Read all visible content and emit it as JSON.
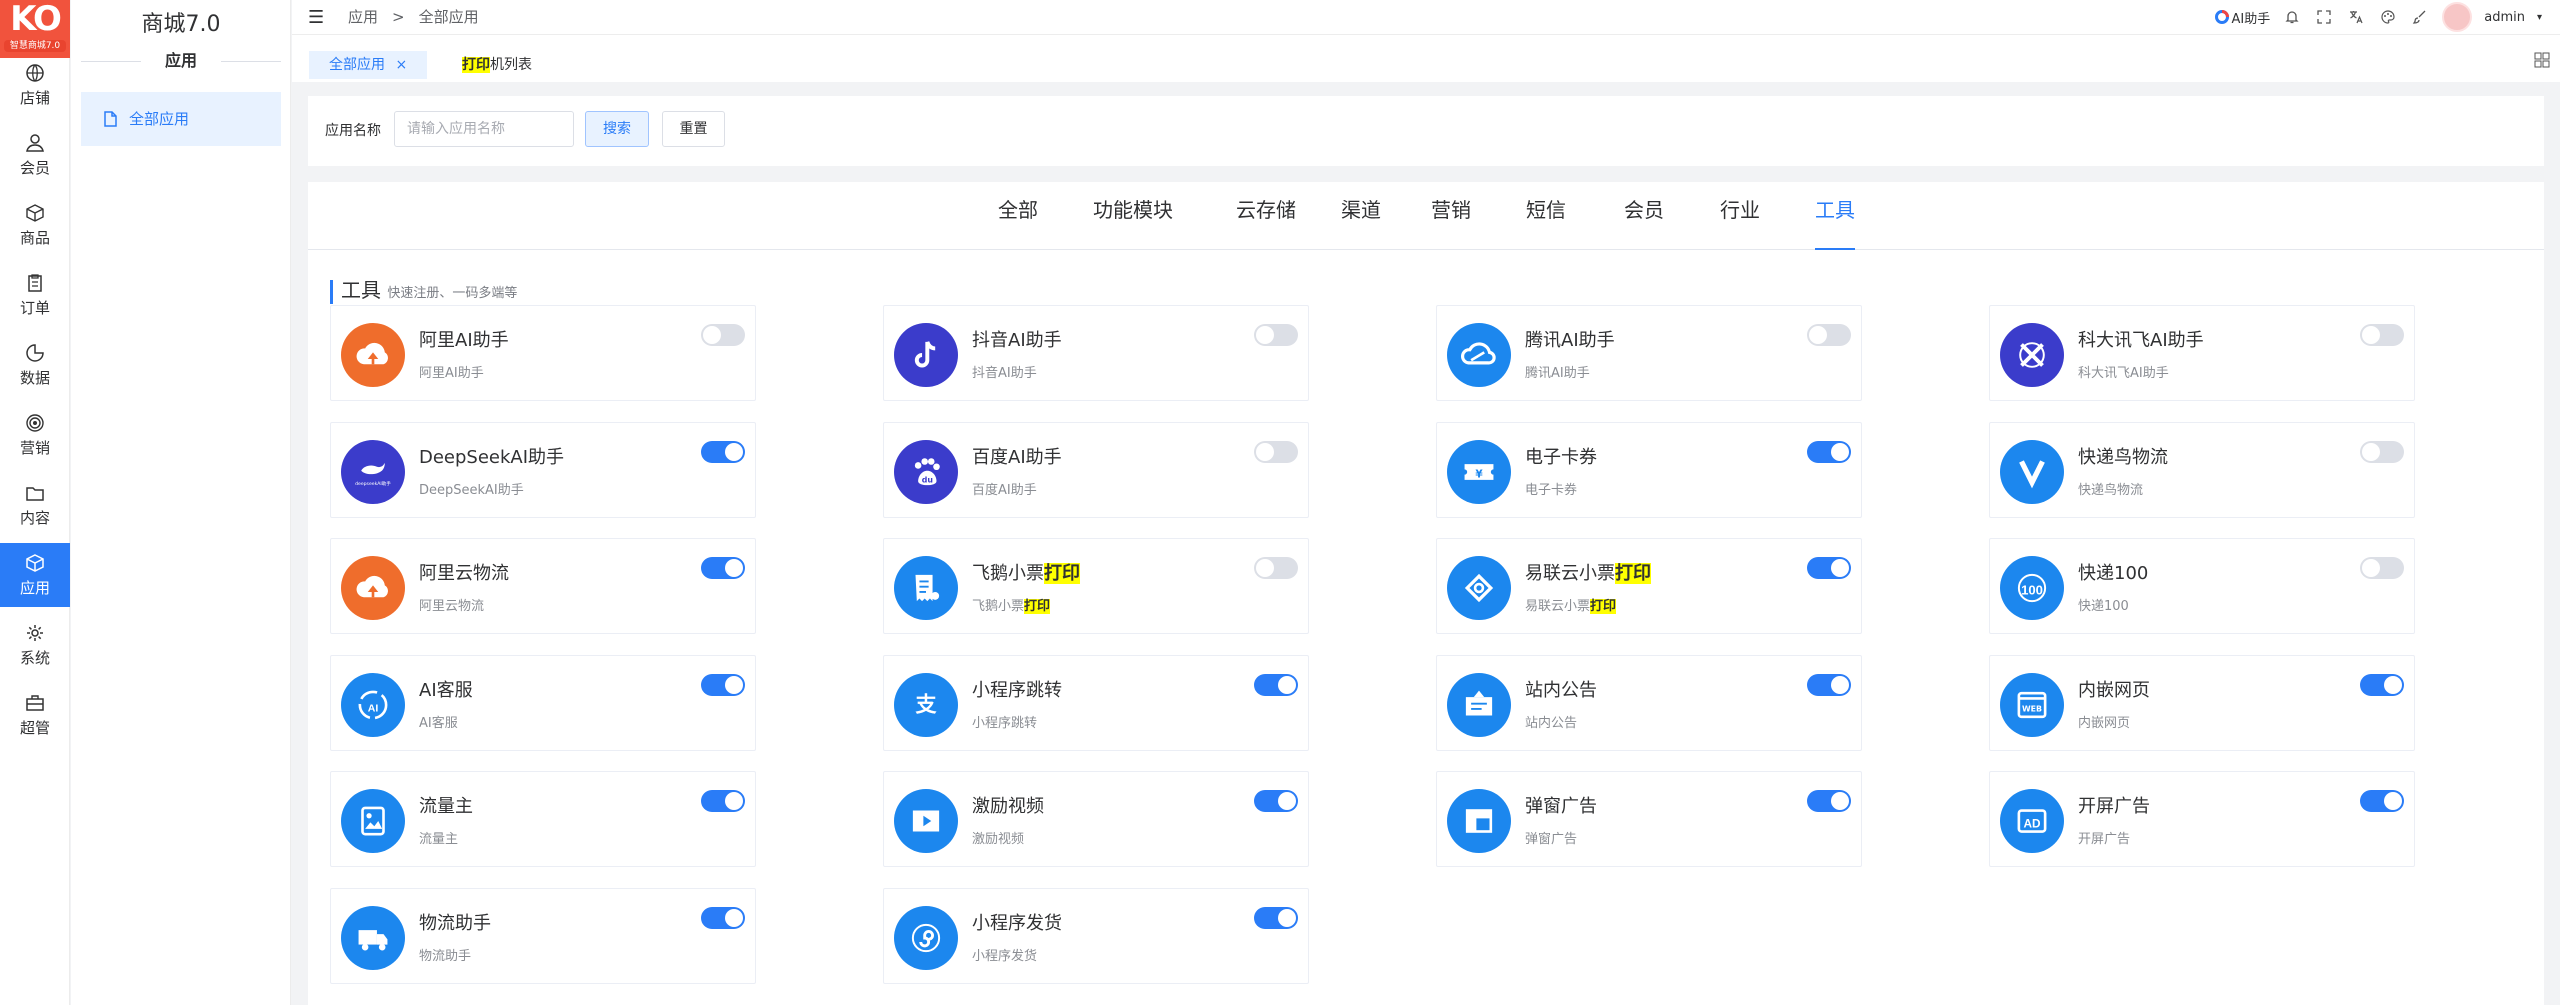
{
  "brand": {
    "mark": "KO",
    "version": "智慧商城7.0"
  },
  "rail": [
    {
      "label": "店铺",
      "icon": "globe-icon"
    },
    {
      "label": "会员",
      "icon": "user-icon"
    },
    {
      "label": "商品",
      "icon": "box-icon"
    },
    {
      "label": "订单",
      "icon": "clipboard-icon"
    },
    {
      "label": "数据",
      "icon": "pie-chart-icon"
    },
    {
      "label": "营销",
      "icon": "target-icon"
    },
    {
      "label": "内容",
      "icon": "folder-icon"
    },
    {
      "label": "应用",
      "icon": "cube-icon",
      "active": true
    },
    {
      "label": "系统",
      "icon": "gear-icon"
    },
    {
      "label": "超管",
      "icon": "briefcase-icon"
    }
  ],
  "sidebar": {
    "title": "商城7.0",
    "section": "应用",
    "item": "全部应用"
  },
  "breadcrumb": {
    "root": "应用",
    "sep": ">",
    "current": "全部应用"
  },
  "header": {
    "ai_label": "AI助手",
    "user": "admin"
  },
  "tabs": {
    "first": "全部应用",
    "close": "×",
    "second_hl": "打印",
    "second_rest": "机列表"
  },
  "filter": {
    "label": "应用名称",
    "placeholder": "请输入应用名称",
    "search": "搜索",
    "reset": "重置"
  },
  "categories": [
    "全部",
    "功能模块",
    "云存储",
    "渠道",
    "营销",
    "短信",
    "会员",
    "行业",
    "工具"
  ],
  "active_category": "工具",
  "section": {
    "title": "工具",
    "subtitle": "快速注册、一码多端等"
  },
  "accent": "#2a7cf7",
  "apps": [
    {
      "name": "阿里AI助手",
      "desc": "阿里AI助手",
      "enabled": false,
      "icon": "cloud-arrow-icon",
      "color": "orange"
    },
    {
      "name": "抖音AI助手",
      "desc": "抖音AI助手",
      "enabled": false,
      "icon": "tiktok-icon",
      "color": "indigo"
    },
    {
      "name": "腾讯AI助手",
      "desc": "腾讯AI助手",
      "enabled": false,
      "icon": "tencent-cloud-icon",
      "color": "blue"
    },
    {
      "name": "科大讯飞AI助手",
      "desc": "科大讯飞AI助手",
      "enabled": false,
      "icon": "iflytek-icon",
      "color": "indigo"
    },
    {
      "name": "DeepSeekAI助手",
      "desc": "DeepSeekAI助手",
      "enabled": true,
      "icon": "whale-icon",
      "color": "indigo",
      "badge": "deepseekAI助手"
    },
    {
      "name": "百度AI助手",
      "desc": "百度AI助手",
      "enabled": false,
      "icon": "baidu-paw-icon",
      "color": "indigo"
    },
    {
      "name": "电子卡券",
      "desc": "电子卡券",
      "enabled": true,
      "icon": "coupon-icon",
      "color": "blue"
    },
    {
      "name": "快递鸟物流",
      "desc": "快递鸟物流",
      "enabled": false,
      "icon": "kdniao-icon",
      "color": "blue"
    },
    {
      "name": "阿里云物流",
      "desc": "阿里云物流",
      "enabled": true,
      "icon": "cloud-arrow-icon",
      "color": "orange"
    },
    {
      "name_pre": "飞鹅小票",
      "name_hl": "打印",
      "desc_pre": "飞鹅小票",
      "desc_hl": "打印",
      "enabled": false,
      "icon": "receipt-icon",
      "color": "blue"
    },
    {
      "name_pre": "易联云小票",
      "name_hl": "打印",
      "desc_pre": "易联云小票",
      "desc_hl": "打印",
      "enabled": true,
      "icon": "link-icon",
      "color": "blue"
    },
    {
      "name": "快递100",
      "desc": "快递100",
      "enabled": false,
      "icon": "kuaidi100-icon",
      "color": "blue",
      "badge": "100"
    },
    {
      "name": "AI客服",
      "desc": "AI客服",
      "enabled": true,
      "icon": "ai-service-icon",
      "color": "blue",
      "badge": "AI"
    },
    {
      "name": "小程序跳转",
      "desc": "小程序跳转",
      "enabled": true,
      "icon": "alipay-icon",
      "color": "blue",
      "badge": "支"
    },
    {
      "name": "站内公告",
      "desc": "站内公告",
      "enabled": true,
      "icon": "notice-icon",
      "color": "blue"
    },
    {
      "name": "内嵌网页",
      "desc": "内嵌网页",
      "enabled": true,
      "icon": "web-icon",
      "color": "blue",
      "badge": "WEB"
    },
    {
      "name": "流量主",
      "desc": "流量主",
      "enabled": true,
      "icon": "photo-icon",
      "color": "blue"
    },
    {
      "name": "激励视频",
      "desc": "激励视频",
      "enabled": true,
      "icon": "video-icon",
      "color": "blue"
    },
    {
      "name": "弹窗广告",
      "desc": "弹窗广告",
      "enabled": true,
      "icon": "popup-icon",
      "color": "blue"
    },
    {
      "name": "开屏广告",
      "desc": "开屏广告",
      "enabled": true,
      "icon": "ad-icon",
      "color": "blue",
      "badge": "AD"
    },
    {
      "name": "物流助手",
      "desc": "物流助手",
      "enabled": true,
      "icon": "truck-icon",
      "color": "blue"
    },
    {
      "name": "小程序发货",
      "desc": "小程序发货",
      "enabled": true,
      "icon": "miniprogram-icon",
      "color": "blue"
    }
  ]
}
